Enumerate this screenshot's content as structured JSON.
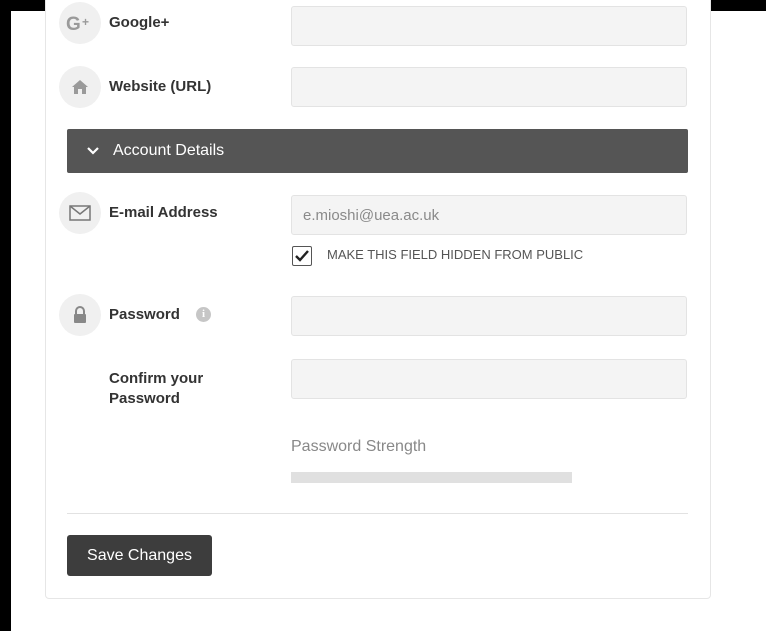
{
  "profile": {
    "googleplus_label": "Google+",
    "website_label": "Website (URL)",
    "googleplus_value": "",
    "website_value": ""
  },
  "account": {
    "section_title": "Account Details",
    "email_label": "E-mail Address",
    "email_value": "e.mioshi@uea.ac.uk",
    "hide_email_checked": true,
    "hide_email_label": "MAKE THIS FIELD HIDDEN FROM PUBLIC",
    "password_label": "Password",
    "password_value": "",
    "confirm_label": "Confirm your Password",
    "confirm_value": "",
    "strength_label": "Password Strength",
    "strength_fraction": 0
  },
  "actions": {
    "save_label": "Save Changes"
  },
  "colors": {
    "section_bar": "#555555",
    "button": "#3d3d3d",
    "field_bg": "#f4f4f4"
  },
  "icons": [
    "googleplus-icon",
    "home-icon",
    "chevron-down-icon",
    "envelope-icon",
    "check-icon",
    "lock-icon",
    "info-icon"
  ]
}
